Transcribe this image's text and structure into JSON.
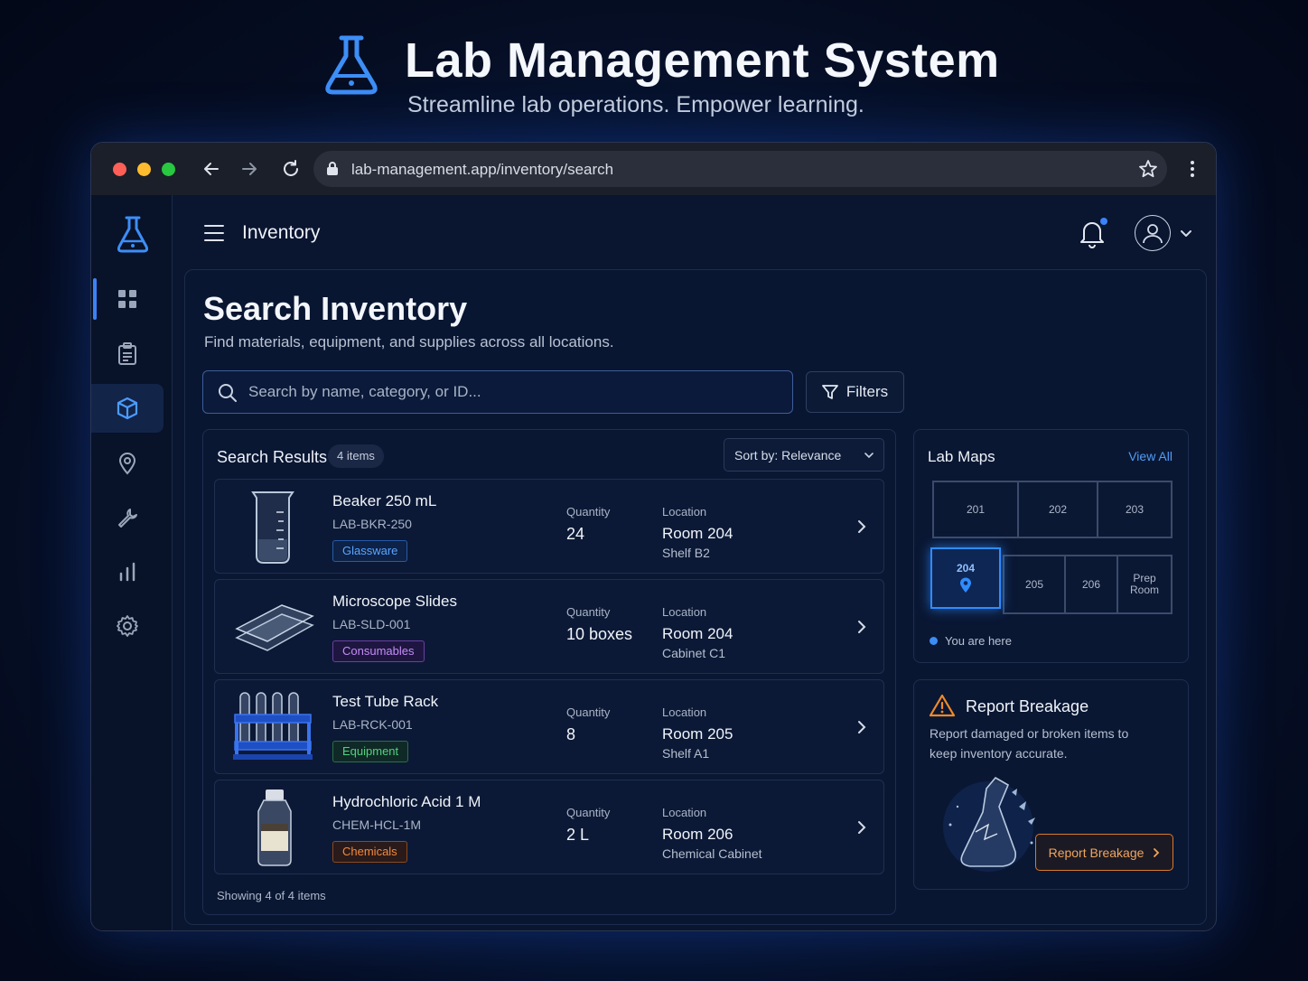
{
  "hero": {
    "title": "Lab Management System",
    "subtitle": "Streamline lab operations. Empower learning."
  },
  "browser": {
    "url": "lab-management.app/inventory/search"
  },
  "sidebar": {
    "items": [
      {
        "name": "dashboard",
        "icon": "grid-icon"
      },
      {
        "name": "tasks",
        "icon": "clipboard-icon"
      },
      {
        "name": "inventory",
        "icon": "cube-icon",
        "active": true
      },
      {
        "name": "locations",
        "icon": "map-pin-icon"
      },
      {
        "name": "maintenance",
        "icon": "wrench-icon"
      },
      {
        "name": "reports",
        "icon": "bar-chart-icon"
      },
      {
        "name": "settings",
        "icon": "gear-icon"
      }
    ]
  },
  "header": {
    "title": "Inventory"
  },
  "page": {
    "title": "Search Inventory",
    "subtitle": "Find materials, equipment, and supplies across all locations."
  },
  "search": {
    "placeholder": "Search by name, category, or ID...",
    "value": ""
  },
  "filters": {
    "label": "Filters"
  },
  "results": {
    "title": "Search Results",
    "count_badge": "4 items",
    "sort_label": "Sort by: Relevance",
    "quantity_label": "Quantity",
    "location_label": "Location",
    "footer": "Showing 4 of 4 items",
    "items": [
      {
        "name": "Beaker 250 mL",
        "id": "LAB-BKR-250",
        "tag": "Glassware",
        "tag_color": "#3b8cf5",
        "quantity": "24",
        "room": "Room 204",
        "spot": "Shelf B2"
      },
      {
        "name": "Microscope Slides",
        "id": "LAB-SLD-001",
        "tag": "Consumables",
        "tag_color": "#b266f0",
        "quantity": "10 boxes",
        "room": "Room 204",
        "spot": "Cabinet C1"
      },
      {
        "name": "Test Tube Rack",
        "id": "LAB-RCK-001",
        "tag": "Equipment",
        "tag_color": "#3fbf6a",
        "quantity": "8",
        "room": "Room 205",
        "spot": "Shelf A1"
      },
      {
        "name": "Hydrochloric Acid 1 M",
        "id": "CHEM-HCL-1M",
        "tag": "Chemicals",
        "tag_color": "#f07a2b",
        "quantity": "2 L",
        "room": "Room 206",
        "spot": "Chemical Cabinet"
      }
    ]
  },
  "lab_maps": {
    "title": "Lab Maps",
    "view_all": "View All",
    "rooms": {
      "r201": "201",
      "r202": "202",
      "r203": "203",
      "r204": "204",
      "r205": "205",
      "r206": "206",
      "prep": "Prep Room"
    },
    "legend": "You are here",
    "current_room": "204"
  },
  "breakage": {
    "title": "Report Breakage",
    "description": "Report damaged or broken items to keep inventory accurate.",
    "button": "Report Breakage",
    "accent": "#f08a2b"
  }
}
